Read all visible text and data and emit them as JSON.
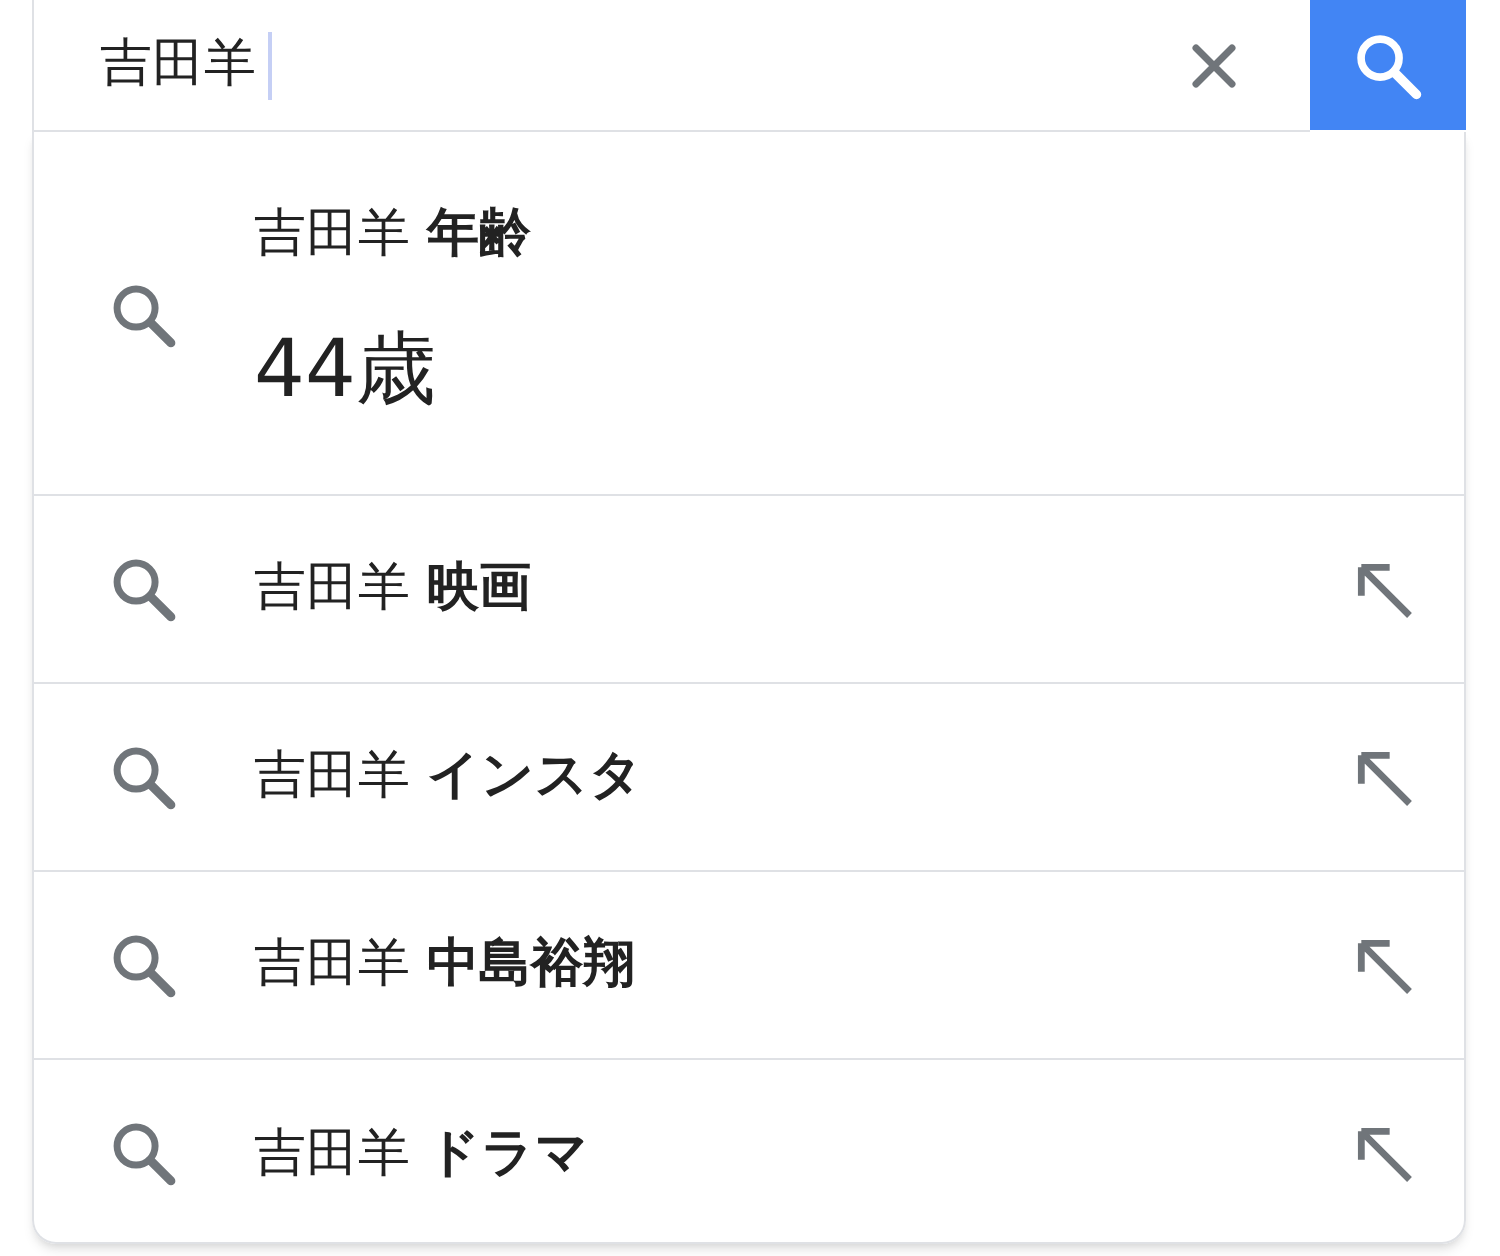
{
  "search": {
    "value": "吉田羊"
  },
  "suggestions": [
    {
      "kind": "answer",
      "text": "吉田羊 **年齢**",
      "answer": "44歳"
    },
    {
      "kind": "query",
      "text": "吉田羊 **映画**"
    },
    {
      "kind": "query",
      "text": "吉田羊 **インスタ**"
    },
    {
      "kind": "query",
      "text": "吉田羊 **中島裕翔**"
    },
    {
      "kind": "query",
      "text": "吉田羊 **ドラマ**"
    }
  ]
}
